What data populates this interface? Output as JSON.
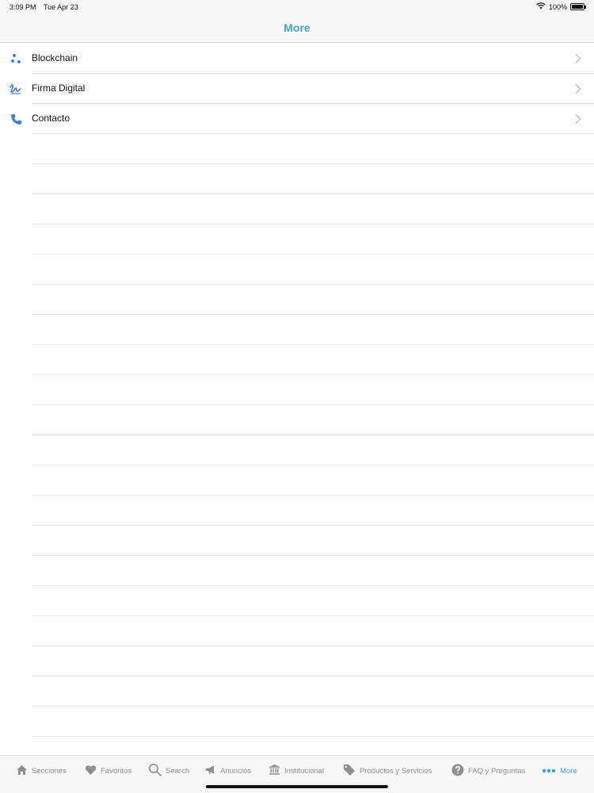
{
  "status_bar": {
    "time": "3:09 PM",
    "date": "Tue Apr 23",
    "battery": "100%"
  },
  "nav": {
    "title": "More"
  },
  "list": {
    "items": [
      {
        "label": "Blockchain",
        "icon": "blockchain-icon"
      },
      {
        "label": "Firma Digital",
        "icon": "signature-icon"
      },
      {
        "label": "Contacto",
        "icon": "phone-icon"
      }
    ]
  },
  "tab_bar": {
    "tabs": [
      {
        "label": "Secciones",
        "icon": "home-icon",
        "active": false
      },
      {
        "label": "Favoritos",
        "icon": "heart-icon",
        "active": false
      },
      {
        "label": "Search",
        "icon": "search-icon",
        "active": false
      },
      {
        "label": "Anuncios",
        "icon": "megaphone-icon",
        "active": false
      },
      {
        "label": "Institucional",
        "icon": "bank-icon",
        "active": false
      },
      {
        "label": "Productos y Servicios",
        "icon": "tag-icon",
        "active": false
      },
      {
        "label": "FAQ y Preguntas",
        "icon": "question-icon",
        "active": false
      },
      {
        "label": "More",
        "icon": "more-dots-icon",
        "active": true
      }
    ]
  },
  "colors": {
    "accent": "#3fa3cf",
    "tab_inactive": "#8e8e93",
    "separator": "#e3e3e3",
    "bar_background": "#f7f7f7"
  }
}
